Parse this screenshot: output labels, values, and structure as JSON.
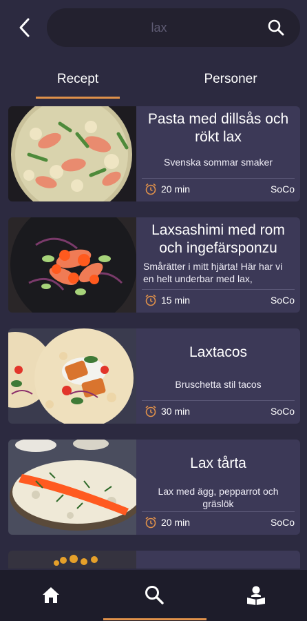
{
  "search": {
    "value": "lax"
  },
  "tabs": [
    {
      "label": "Recept",
      "active": true
    },
    {
      "label": "Personer",
      "active": false
    }
  ],
  "recipes": [
    {
      "title": "Pasta med dillsås och rökt lax",
      "description": "Svenska sommar smaker",
      "time": "20 min",
      "author": "SoCo",
      "image": "pasta-salmon-dish"
    },
    {
      "title": "Laxsashimi med rom och ingefärsponzu",
      "description": "Smårätter i mitt hjärta! Här har vi en helt underbar med lax,",
      "time": "15 min",
      "author": "SoCo",
      "image": "salmon-sashimi-plate"
    },
    {
      "title": "Laxtacos",
      "description": "Bruschetta stil tacos",
      "time": "30 min",
      "author": "SoCo",
      "image": "salmon-tacos"
    },
    {
      "title": "Lax tårta",
      "description": "Lax med ägg, pepparrot och gräslök",
      "time": "20 min",
      "author": "SoCo",
      "image": "salmon-cake"
    }
  ],
  "nav": {
    "items": [
      "home-icon",
      "search-icon",
      "profile-reader-icon"
    ],
    "active": "search-icon"
  },
  "colors": {
    "background": "#2c2a40",
    "card": "#3c3957",
    "accent": "#e0914a",
    "nav": "#1d1c2a",
    "clock": "#e0914a"
  }
}
